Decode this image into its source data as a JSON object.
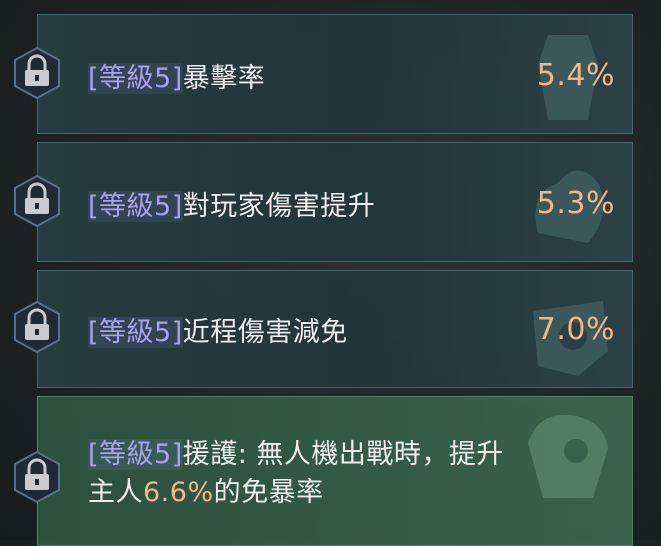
{
  "perks": [
    {
      "level_tag": "[等級5]",
      "name": "暴擊率",
      "value": "5.4%"
    },
    {
      "level_tag": "[等級5]",
      "name": "對玩家傷害提升",
      "value": "5.3%"
    },
    {
      "level_tag": "[等級5]",
      "name": "近程傷害減免",
      "value": "7.0%"
    }
  ],
  "special": {
    "level_tag": "[等級5]",
    "text_a": "援護: 無人機出戰時，提升",
    "text_b": "主人",
    "highlight": "6.6%",
    "text_c": "的免暴率"
  },
  "icons": [
    "padlock-icon",
    "drone-silhouette-icon"
  ],
  "colors": {
    "level_tag": "#a6a2ec",
    "value": "#f2b58c",
    "text": "#eeeeee",
    "active_row": "#3a6a52"
  }
}
